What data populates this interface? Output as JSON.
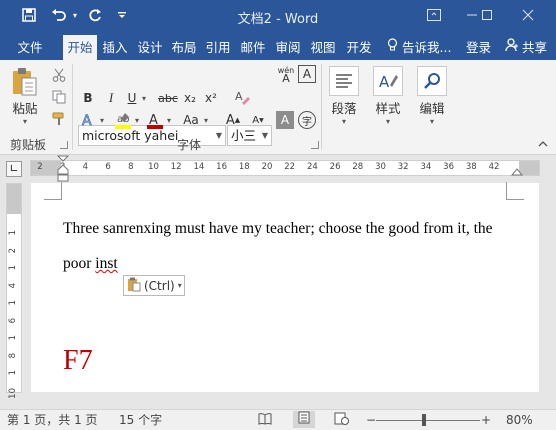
{
  "window": {
    "title": "文档2 - Word"
  },
  "quick_access": {
    "save_icon": "save-icon",
    "undo_icon": "undo-icon",
    "redo_icon": "redo-icon",
    "customize_icon": "customize-icon"
  },
  "tabs": [
    {
      "label": "文件",
      "active": false
    },
    {
      "label": "开始",
      "active": true
    },
    {
      "label": "插入",
      "active": false
    },
    {
      "label": "设计",
      "active": false
    },
    {
      "label": "布局",
      "active": false
    },
    {
      "label": "引用",
      "active": false
    },
    {
      "label": "邮件",
      "active": false
    },
    {
      "label": "审阅",
      "active": false
    },
    {
      "label": "视图",
      "active": false
    },
    {
      "label": "开发",
      "active": false
    }
  ],
  "tell_me": "告诉我...",
  "login": "登录",
  "share": "共享",
  "ribbon": {
    "clipboard": {
      "paste_label": "粘贴",
      "group_label": "剪贴板"
    },
    "font": {
      "font_name": "microsoft yahei",
      "font_size": "小三",
      "phonetic_label": "wén",
      "bold": "B",
      "italic": "I",
      "underline": "U",
      "strike": "abc",
      "subscript": "x₂",
      "superscript": "x²",
      "case_label": "Aa",
      "grow": "A",
      "shrink": "A",
      "enclose": "字",
      "group_label": "字体"
    },
    "paragraph": {
      "label": "段落"
    },
    "styles": {
      "label": "样式"
    },
    "editing": {
      "label": "编辑"
    }
  },
  "ruler_ticks": [
    "2",
    "2",
    "4",
    "6",
    "8",
    "10",
    "12",
    "14",
    "16",
    "18",
    "20",
    "22",
    "24",
    "26",
    "28",
    "30",
    "32",
    "34",
    "36",
    "38",
    "42"
  ],
  "vruler_ticks": [
    "1",
    "2",
    "1",
    "4",
    "1",
    "6",
    "1",
    "8",
    "1",
    "10"
  ],
  "document": {
    "line1": "Three sanrenxing must have my teacher; choose the good from it, the",
    "line2_before": "poor ",
    "line2_err": "inst",
    "paste_options": "(Ctrl)",
    "marker": "F7"
  },
  "status": {
    "page": "第 1 页，共 1 页",
    "words": "15 个字",
    "zoom": "80%",
    "zoom_minus": "−",
    "zoom_plus": "+"
  },
  "colors": {
    "accent": "#2b579a",
    "highlight": "#ffff00",
    "font_color": "#c00000"
  }
}
